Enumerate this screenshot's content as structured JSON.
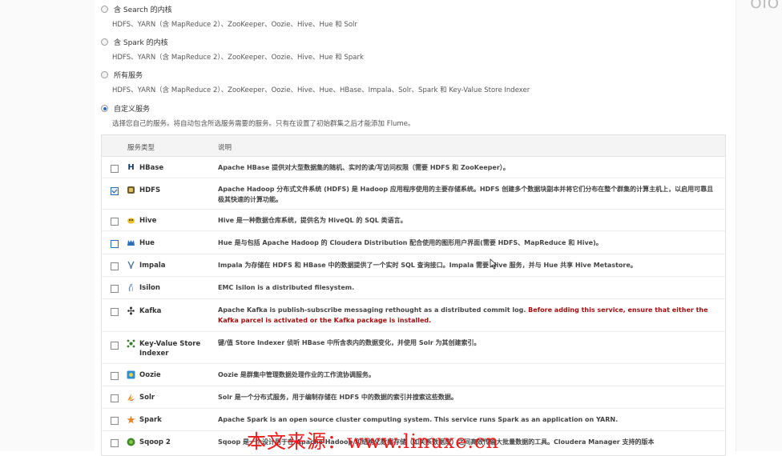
{
  "service_options": [
    {
      "title": "含 Search 的内核",
      "desc": "HDFS、YARN（含 MapReduce 2）、ZooKeeper、Oozie、Hive、Hue 和 Solr",
      "selected": false
    },
    {
      "title": "含 Spark 的内核",
      "desc": "HDFS、YARN（含 MapReduce 2）、ZooKeeper、Oozie、Hive、Hue 和 Spark",
      "selected": false
    },
    {
      "title": "所有服务",
      "desc": "HDFS、YARN（含 MapReduce 2）、ZooKeeper、Oozie、Hive、Hue、HBase、Impala、Solr、Spark 和 Key-Value Store Indexer",
      "selected": false
    },
    {
      "title": "自定义服务",
      "desc": "选择您自己的服务。将自动包含所选服务需要的服务。只有在设置了初始群集之后才能添加 Flume。",
      "selected": true
    }
  ],
  "table": {
    "col_service": "服务类型",
    "col_desc": "说明",
    "rows": [
      {
        "name": "HBase",
        "icon": "hbase-icon",
        "checked": false,
        "desc": "Apache HBase 提供对大型数据集的随机、实时的读/写访问权限（需要 HDFS 和 ZooKeeper）。"
      },
      {
        "name": "HDFS",
        "icon": "hdfs-icon",
        "checked": true,
        "desc": "Apache Hadoop 分布式文件系统 (HDFS) 是 Hadoop 应用程序使用的主要存储系统。HDFS 创建多个数据块副本并将它们分布在整个群集的计算主机上，以启用可靠且极其快速的计算功能。"
      },
      {
        "name": "Hive",
        "icon": "hive-icon",
        "checked": false,
        "desc": "Hive 是一种数据仓库系统，提供名为 HiveQL 的 SQL 类语言。"
      },
      {
        "name": "Hue",
        "icon": "hue-icon",
        "checked": false,
        "desc": "Hue 是与包括 Apache Hadoop 的 Cloudera Distribution 配合使用的图形用户界面(需要 HDFS、MapReduce 和 Hive)。"
      },
      {
        "name": "Impala",
        "icon": "impala-icon",
        "checked": false,
        "desc": "Impala 为存储在 HDFS 和 HBase 中的数据提供了一个实时 SQL 查询接口。Impala 需要 Hive 服务，并与 Hue 共享 Hive Metastore。"
      },
      {
        "name": "Isilon",
        "icon": "isilon-icon",
        "checked": false,
        "desc": "EMC Isilon is a distributed filesystem."
      },
      {
        "name": "Kafka",
        "icon": "kafka-icon",
        "checked": false,
        "desc": "Apache Kafka is publish-subscribe messaging rethought as a distributed commit log. ",
        "warn": "Before adding this service, ensure that either the Kafka parcel is activated or the Kafka package is installed."
      },
      {
        "name": "Key-Value Store Indexer",
        "icon": "keyvalue-icon",
        "checked": false,
        "desc": "键/值 Store Indexer 侦听 HBase 中所含表内的数据变化，并使用 Solr 为其创建索引。"
      },
      {
        "name": "Oozie",
        "icon": "oozie-icon",
        "checked": false,
        "desc": "Oozie 是群集中管理数据处理作业的工作流协调服务。"
      },
      {
        "name": "Solr",
        "icon": "solr-icon",
        "checked": false,
        "desc": "Solr 是一个分布式服务，用于编制存储在 HDFS 中的数据的索引并搜索这些数据。"
      },
      {
        "name": "Spark",
        "icon": "spark-icon",
        "checked": false,
        "desc": "Apache Spark is an open source cluster computing system. This service runs Spark as an application on YARN."
      },
      {
        "name": "Sqoop 2",
        "icon": "sqoop-icon",
        "checked": false,
        "desc": "Sqoop 是一个设计用于在 Apache Hadoop 和结构化数据存储（如关系数据库）之间高效传输大批量数据的工具。Cloudera Manager 支持的版本"
      }
    ]
  },
  "watermark": "本文来源：www.linuxe.cn",
  "corner_logo": "OIO"
}
